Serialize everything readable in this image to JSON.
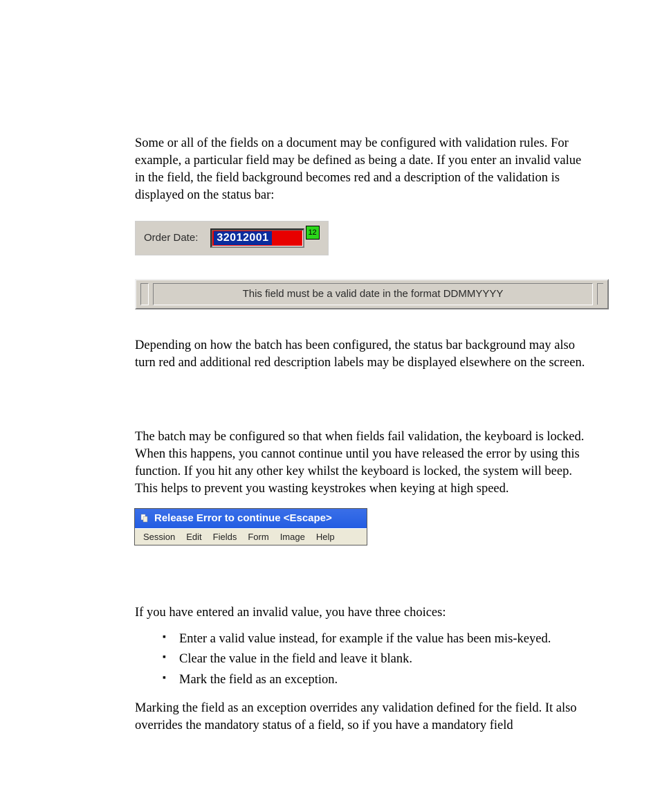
{
  "paragraphs": {
    "p1": "Some or all of the fields on a document may be configured with validation rules. For example, a particular field may be defined as being a date. If you enter an invalid value in the field, the field background becomes red and a description of the validation is displayed on the status bar:",
    "p2": "Depending on how the batch has been configured, the status bar background may also turn red and additional red description labels may be displayed elsewhere on the screen.",
    "p3": "The batch may be configured so that when fields fail validation, the keyboard is locked. When this happens, you cannot continue until you have released the error by using this function. If you hit any other key whilst the keyboard is locked, the system will beep. This helps to prevent you wasting keystrokes when keying at high speed.",
    "p4": "If you have entered an invalid value, you have three choices:",
    "p5": "Marking the field as an exception overrides any validation defined for the field. It also overrides the mandatory status of a field, so if you have a mandatory field"
  },
  "orderDate": {
    "label": "Order Date:",
    "value": "32012001",
    "iconText": "12"
  },
  "statusBar": {
    "message": "This field must be a valid date in the format DDMMYYYY"
  },
  "releaseError": {
    "title": "Release Error to continue <Escape>",
    "menu": [
      "Session",
      "Edit",
      "Fields",
      "Form",
      "Image",
      "Help"
    ]
  },
  "choices": [
    "Enter a valid value instead, for example if the value has been mis-keyed.",
    "Clear the value in the field and leave it blank.",
    "Mark the field as an exception."
  ]
}
